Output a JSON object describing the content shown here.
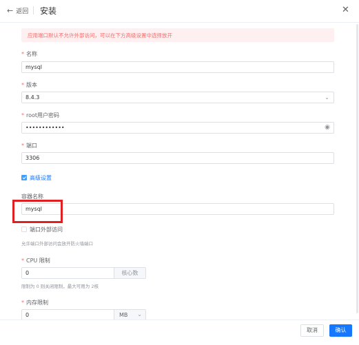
{
  "header": {
    "back_label": "返回",
    "title": "安装"
  },
  "alert": "应用端口默认不允许外部访问，可以在下方高级设置中选择放开",
  "form": {
    "name": {
      "label": "名称",
      "value": "mysql"
    },
    "version": {
      "label": "版本",
      "value": "8.4.3"
    },
    "root_password": {
      "label": "root用户密码",
      "value": "••••••••••••"
    },
    "port": {
      "label": "端口",
      "value": "3306"
    },
    "advanced": {
      "label": "高级设置",
      "checked": true
    },
    "container_name": {
      "label": "容器名称",
      "value": "mysql"
    },
    "port_external": {
      "label": "端口外部访问",
      "checked": false,
      "hint": "允许端口外部访问会放开防火墙端口"
    },
    "cpu_limit": {
      "label": "CPU 限制",
      "value": "0",
      "unit": "核心数",
      "hint": "限制为 0 则关闭限制，最大可用为 2核"
    },
    "memory_limit": {
      "label": "内存限制",
      "value": "0",
      "unit": "MB"
    }
  },
  "footer": {
    "cancel_label": "取消",
    "confirm_label": "确认"
  },
  "colors": {
    "primary": "#1677ff",
    "danger": "#f56c6c",
    "highlight": "#e02020"
  }
}
